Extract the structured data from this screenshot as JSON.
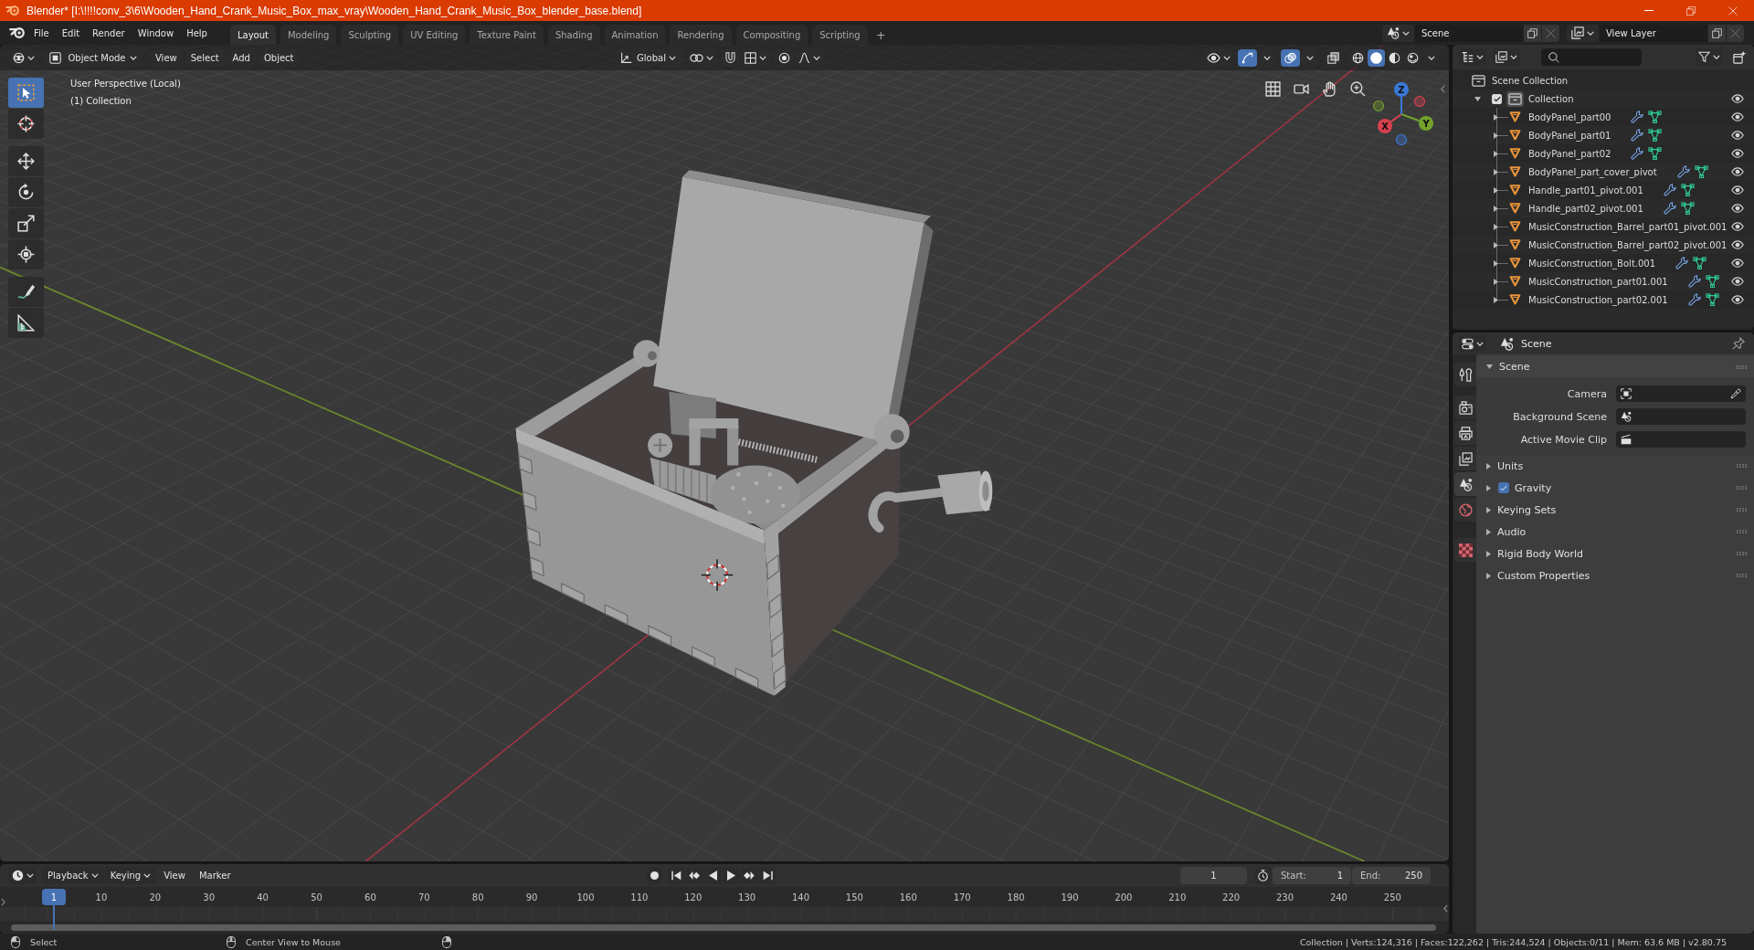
{
  "window": {
    "title": "Blender* [I:\\!!!!conv_3\\6\\Wooden_Hand_Crank_Music_Box_max_vray\\Wooden_Hand_Crank_Music_Box_blender_base.blend]"
  },
  "topbar": {
    "menus": [
      "File",
      "Edit",
      "Render",
      "Window",
      "Help"
    ],
    "workspaces": [
      {
        "label": "Layout",
        "selected": true
      },
      {
        "label": "Modeling",
        "selected": false
      },
      {
        "label": "Sculpting",
        "selected": false
      },
      {
        "label": "UV Editing",
        "selected": false
      },
      {
        "label": "Texture Paint",
        "selected": false
      },
      {
        "label": "Shading",
        "selected": false
      },
      {
        "label": "Animation",
        "selected": false
      },
      {
        "label": "Rendering",
        "selected": false
      },
      {
        "label": "Compositing",
        "selected": false
      },
      {
        "label": "Scripting",
        "selected": false
      }
    ],
    "add_workspace": "+",
    "scene": "Scene",
    "view_layer": "View Layer"
  },
  "viewport": {
    "header": {
      "mode": "Object Mode",
      "menus": [
        "View",
        "Select",
        "Add",
        "Object"
      ],
      "orientation": "Global",
      "toggles": [
        {
          "kind": "gizmos",
          "on": true
        },
        {
          "kind": "overlays",
          "on": true
        },
        {
          "kind": "xray",
          "on": false
        }
      ],
      "shading": [
        {
          "kind": "wireframe",
          "selected": false
        },
        {
          "kind": "solid",
          "selected": true
        },
        {
          "kind": "material",
          "selected": false
        },
        {
          "kind": "rendered",
          "selected": false
        }
      ]
    },
    "tools": [
      {
        "kind": "select_box",
        "selected": true
      },
      {
        "kind": "cursor",
        "selected": false
      },
      {
        "kind": "move",
        "selected": false
      },
      {
        "kind": "rotate",
        "selected": false
      },
      {
        "kind": "scale",
        "selected": false
      },
      {
        "kind": "transform",
        "selected": false
      },
      {
        "kind": "annotate",
        "selected": false
      },
      {
        "kind": "measure",
        "selected": false
      }
    ],
    "view_name": "User Perspective (Local)",
    "collection_label": "(1) Collection",
    "axes": [
      {
        "label": "X",
        "color": "#d9414f"
      },
      {
        "label": "Y",
        "color": "#74a22c"
      },
      {
        "label": "Z",
        "color": "#3a78d8"
      }
    ]
  },
  "outliner": {
    "root": "Scene Collection",
    "collections": [
      {
        "label": "Collection",
        "checked": true,
        "expanded": true,
        "active": true,
        "children": [
          {
            "label": "BodyPanel_part00",
            "expanded": false,
            "data_icons": true
          },
          {
            "label": "BodyPanel_part01",
            "expanded": false,
            "data_icons": true
          },
          {
            "label": "BodyPanel_part02",
            "expanded": false,
            "data_icons": true
          },
          {
            "label": "BodyPanel_part_cover_pivot",
            "expanded": false,
            "data_icons": true
          },
          {
            "label": "Handle_part01_pivot.001",
            "expanded": false,
            "data_icons": true
          },
          {
            "label": "Handle_part02_pivot.001",
            "expanded": false,
            "data_icons": true
          },
          {
            "label": "MusicConstruction_Barrel_part01_pivot.001",
            "expanded": false,
            "data_icons": false
          },
          {
            "label": "MusicConstruction_Barrel_part02_pivot.001",
            "expanded": false,
            "data_icons": false
          },
          {
            "label": "MusicConstruction_Bolt.001",
            "expanded": false,
            "data_icons": true
          },
          {
            "label": "MusicConstruction_part01.001",
            "expanded": false,
            "data_icons": true
          },
          {
            "label": "MusicConstruction_part02.001",
            "expanded": false,
            "data_icons": true
          }
        ]
      }
    ]
  },
  "properties": {
    "tabs": [
      {
        "kind": "tool",
        "selected": false
      },
      {
        "kind": "render",
        "selected": false
      },
      {
        "kind": "output",
        "selected": false
      },
      {
        "kind": "view_layer",
        "selected": false
      },
      {
        "kind": "scene",
        "selected": true
      },
      {
        "kind": "world",
        "selected": false
      },
      {
        "kind": "texture",
        "selected": false
      }
    ],
    "context": "Scene",
    "panel": {
      "title": "Scene",
      "expanded": true,
      "fields": [
        {
          "label": "Camera",
          "kind": "object"
        },
        {
          "label": "Background Scene",
          "kind": "scene"
        },
        {
          "label": "Active Movie Clip",
          "kind": "clip"
        }
      ]
    },
    "subpanels": [
      {
        "title": "Units",
        "expanded": false
      },
      {
        "title": "Gravity",
        "expanded": false,
        "toggle": {
          "checked": true
        }
      },
      {
        "title": "Keying Sets",
        "expanded": false
      },
      {
        "title": "Audio",
        "expanded": false
      },
      {
        "title": "Rigid Body World",
        "expanded": false
      },
      {
        "title": "Custom Properties",
        "expanded": false
      }
    ]
  },
  "timeline": {
    "menus": [
      {
        "label": "Playback",
        "dropdown": true
      },
      {
        "label": "Keying",
        "dropdown": true
      },
      {
        "label": "View",
        "dropdown": false
      },
      {
        "label": "Marker",
        "dropdown": false
      }
    ],
    "current_frame": "1",
    "start": {
      "label": "Start:",
      "value": "1"
    },
    "end": {
      "label": "End:",
      "value": "250"
    },
    "playhead": "1",
    "ruler": [
      "10",
      "20",
      "30",
      "40",
      "50",
      "60",
      "70",
      "80",
      "90",
      "100",
      "110",
      "120",
      "130",
      "140",
      "150",
      "160",
      "170",
      "180",
      "190",
      "200",
      "210",
      "220",
      "230",
      "240",
      "250"
    ]
  },
  "status_bar": {
    "hints": [
      {
        "kind": "left_mouse",
        "label": "Select"
      },
      {
        "kind": "middle_mouse",
        "label": "Center View to Mouse"
      },
      {
        "kind": "right_mouse"
      }
    ],
    "stats": "Collection | Verts:124,316 | Faces:122,262 | Tris:244,524 | Objects:0/11 | Mem: 63.6 MB | v2.80.75"
  }
}
